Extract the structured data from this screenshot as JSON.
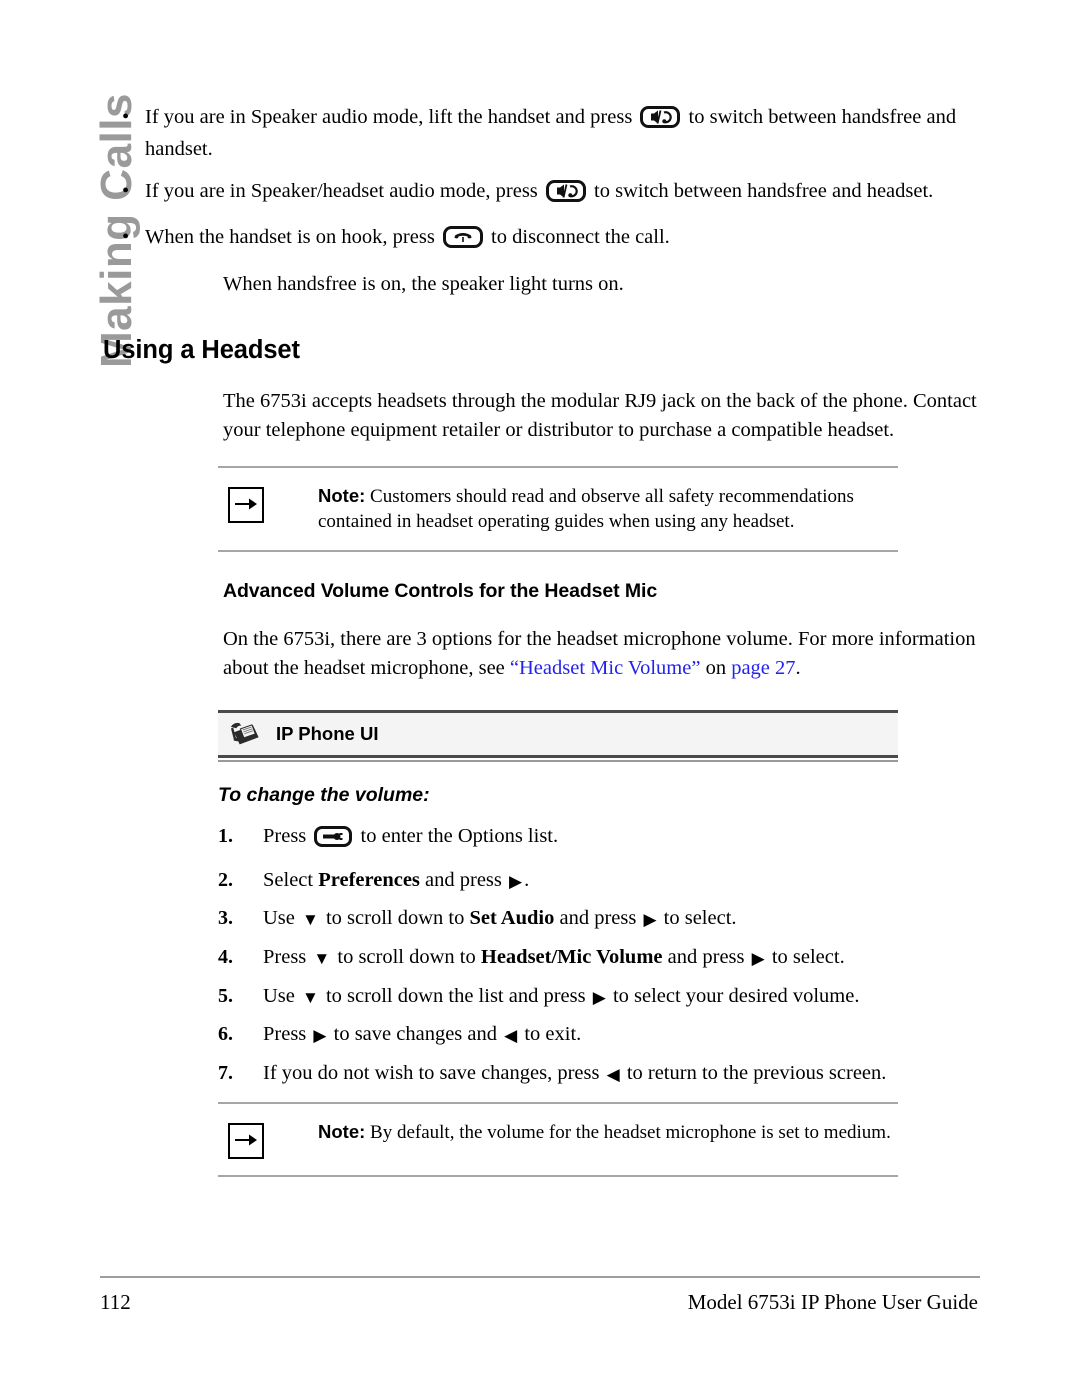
{
  "sidebar": {
    "chapter_tab": "Making Calls"
  },
  "bullets": [
    {
      "before": "If you are in Speaker audio mode, lift the handset and press",
      "icon": "speaker-headset-key-icon",
      "after": "to switch between handsfree and handset."
    },
    {
      "before": "If you are in Speaker/headset audio mode, press",
      "icon": "speaker-headset-key-icon",
      "after": "to switch between handsfree and headset."
    },
    {
      "before": "When the handset is on hook, press",
      "icon": "goodbye-key-icon",
      "after": "to disconnect the call."
    }
  ],
  "intro_paragraph": "When handsfree is on, the speaker light turns on.",
  "section": {
    "title": "Using a Headset",
    "paragraph": "The 6753i accepts headsets through the modular RJ9 jack on the back of the phone. Contact your telephone equipment retailer or distributor to purchase a compatible headset."
  },
  "note_top": {
    "icon": "right-arrow-note-icon",
    "label": "Note:",
    "text": "Customers should read and observe all safety recommendations contained in headset operating guides when using any headset."
  },
  "subsection": {
    "title": "Advanced Volume Controls for the Headset Mic",
    "paragraph_part1": "On the 6753i, there are 3 options for the headset microphone volume. For more information about the headset microphone, see ",
    "link_quote": "“Headset Mic Volume”",
    "paragraph_part2": " on ",
    "link_page": "page 27",
    "paragraph_end": "."
  },
  "ip_phone_ui": {
    "icon": "desk-phone-icon",
    "label": "IP Phone UI"
  },
  "procedure_title": "To change the volume:",
  "steps": [
    {
      "num": "1.",
      "segments": [
        {
          "type": "text",
          "value": "Press "
        },
        {
          "type": "key",
          "value": "options-key-icon"
        },
        {
          "type": "text",
          "value": " to enter the Options list."
        }
      ]
    },
    {
      "num": "2.",
      "segments": [
        {
          "type": "text",
          "value": "Select "
        },
        {
          "type": "bold",
          "value": "Preferences"
        },
        {
          "type": "text",
          "value": " and press "
        },
        {
          "type": "tri",
          "value": "right"
        },
        {
          "type": "text",
          "value": "."
        }
      ]
    },
    {
      "num": "3.",
      "segments": [
        {
          "type": "text",
          "value": "Use "
        },
        {
          "type": "tri",
          "value": "down"
        },
        {
          "type": "text",
          "value": " to scroll down to "
        },
        {
          "type": "bold",
          "value": "Set Audio"
        },
        {
          "type": "text",
          "value": " and press "
        },
        {
          "type": "tri",
          "value": "right"
        },
        {
          "type": "text",
          "value": " to select."
        }
      ]
    },
    {
      "num": "4.",
      "segments": [
        {
          "type": "text",
          "value": "Press "
        },
        {
          "type": "tri",
          "value": "down"
        },
        {
          "type": "text",
          "value": " to scroll down to "
        },
        {
          "type": "bold",
          "value": "Headset/Mic Volume"
        },
        {
          "type": "text",
          "value": " and press "
        },
        {
          "type": "tri",
          "value": "right"
        },
        {
          "type": "text",
          "value": " to select."
        }
      ]
    },
    {
      "num": "5.",
      "segments": [
        {
          "type": "text",
          "value": "Use "
        },
        {
          "type": "tri",
          "value": "down"
        },
        {
          "type": "text",
          "value": " to scroll down the list and press "
        },
        {
          "type": "tri",
          "value": "right"
        },
        {
          "type": "text",
          "value": " to select your desired volume."
        }
      ]
    },
    {
      "num": "6.",
      "segments": [
        {
          "type": "text",
          "value": "Press "
        },
        {
          "type": "tri",
          "value": "right"
        },
        {
          "type": "text",
          "value": " to save changes and "
        },
        {
          "type": "tri",
          "value": "left"
        },
        {
          "type": "text",
          "value": " to exit."
        }
      ]
    },
    {
      "num": "7.",
      "segments": [
        {
          "type": "text",
          "value": "If you do not wish to save changes, press "
        },
        {
          "type": "tri",
          "value": "left"
        },
        {
          "type": "text",
          "value": " to return to the previous screen."
        }
      ]
    }
  ],
  "note_bottom": {
    "icon": "right-arrow-note-icon",
    "label": "Note:",
    "text": "By default, the volume for the headset microphone is set to medium."
  },
  "footer": {
    "page_number": "112",
    "guide_title": "Model 6753i IP Phone User Guide"
  },
  "colors": {
    "link": "#2222ee",
    "tab_gray": "#9a9a9a",
    "rule_gray": "#a6a6a6",
    "banner_bg": "#f4f4f4"
  }
}
